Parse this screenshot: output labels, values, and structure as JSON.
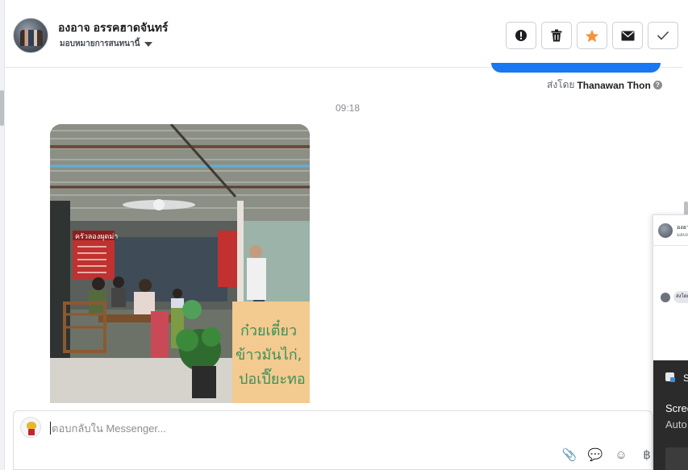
{
  "header": {
    "contact_name": "องอาจ อรรคฮาดจันทร์",
    "assign_label": "มอบหมายการสนทนานี้",
    "actions": [
      {
        "name": "report-button",
        "icon": "alert-icon"
      },
      {
        "name": "delete-button",
        "icon": "trash-icon"
      },
      {
        "name": "star-button",
        "icon": "star-icon"
      },
      {
        "name": "mark-unread-button",
        "icon": "envelope-icon"
      },
      {
        "name": "mark-done-button",
        "icon": "check-icon"
      }
    ]
  },
  "thread": {
    "sent_by_prefix": "ส่งโดย",
    "sent_by_name": "Thanawan Thon",
    "timestamp": "09:18",
    "photo_sign_lines": [
      "ก๋วยเตี๋ยว",
      "ข้าวมันไก่,",
      "ปอเปี๊ยะทอ"
    ],
    "photo_menu_label": "ครัวลองผุดม่า"
  },
  "composer": {
    "placeholder": "ตอบกลับใน Messenger...",
    "tools": [
      {
        "name": "attach-icon",
        "glyph": "📎"
      },
      {
        "name": "saved-replies-icon",
        "glyph": "💬"
      },
      {
        "name": "emoji-icon",
        "glyph": "☺"
      },
      {
        "name": "baht-icon",
        "glyph": "฿"
      }
    ]
  },
  "side_panel": {
    "item1_title": "องอา",
    "item1_sub": "มอบหมา",
    "item2_chip": "ส่งโดย",
    "notif_title": "S",
    "notif_line1": "Scree",
    "notif_line2": "Auto"
  },
  "colors": {
    "accent": "#1877f2",
    "star": "#f7923b",
    "border": "#ccd0d5"
  }
}
